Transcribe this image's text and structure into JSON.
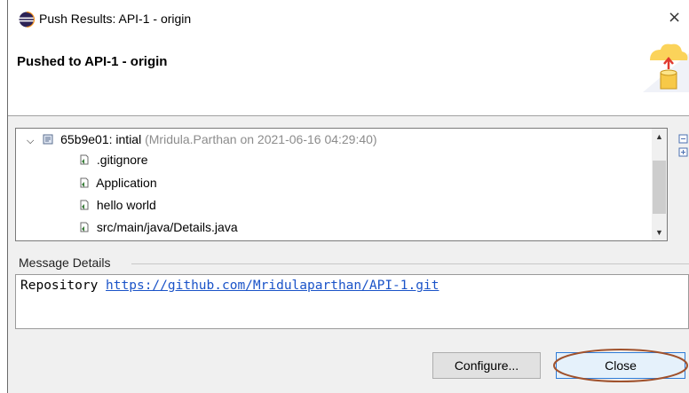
{
  "window": {
    "title": "Push Results: API-1 - origin",
    "close_glyph": "×",
    "icon": "eclipse-icon"
  },
  "header": {
    "title": "Pushed to API-1 - origin",
    "graphic": "push-cylinder-icon"
  },
  "tree": {
    "commit": {
      "label": "65b9e01: intial",
      "meta": "(Mridula.Parthan on 2021-06-16 04:29:40)"
    },
    "files": [
      {
        "label": ".gitignore"
      },
      {
        "label": "Application"
      },
      {
        "label": "hello world"
      },
      {
        "label": "src/main/java/Details.java"
      }
    ]
  },
  "message": {
    "section_label": "Message Details",
    "prefix": "Repository",
    "link": "https://github.com/Mridulaparthan/API-1.git"
  },
  "buttons": {
    "configure": "Configure...",
    "close": "Close"
  },
  "colors": {
    "link": "#1a53c8",
    "close_highlight_ring": "#a0522d",
    "focus_border": "#2f7bd6"
  }
}
